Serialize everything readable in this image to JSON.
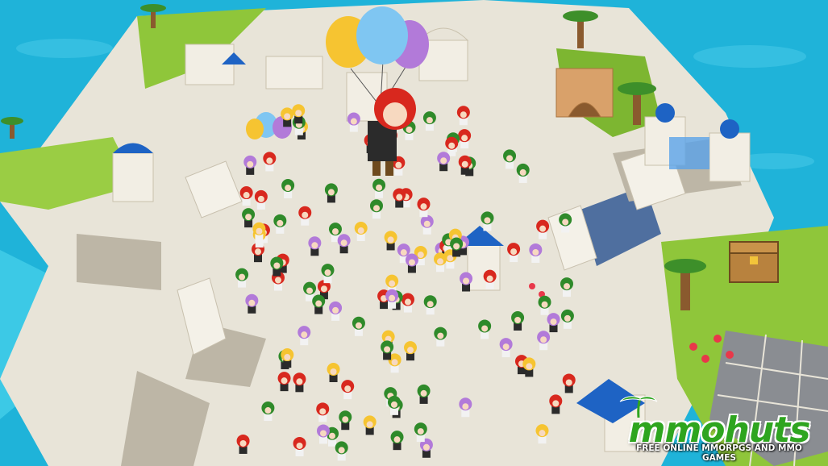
{
  "scene": {
    "name": "isometric island town with crowd of player characters",
    "colors": {
      "ocean": "#1fb3d9",
      "ocean_light": "#4fd1ec",
      "grass": "#8fc63a",
      "stone": "#e8e4d8",
      "stone_shadow": "#bdb6a6",
      "roof_blue": "#1e63c4",
      "balloon_yellow": "#f6c431",
      "balloon_blue": "#7fc6f2",
      "balloon_purple": "#b27ad9",
      "hair_red": "#d8281e",
      "watermelon_green": "#2f8a2a"
    }
  },
  "watermark": {
    "brand": "mmohuts",
    "tagline": "FREE ONLINE MMORPGS AND MMO GAMES",
    "icon": "palm-tree-icon",
    "color": "#2ea51f"
  }
}
